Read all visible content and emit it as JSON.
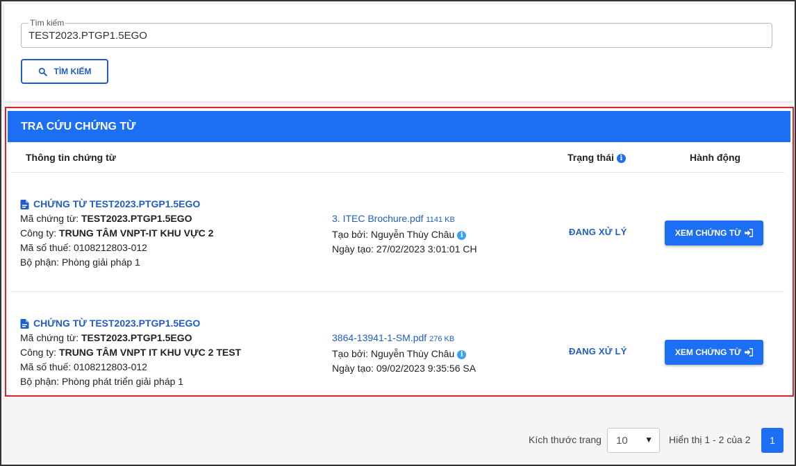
{
  "search": {
    "label": "Tìm kiếm",
    "value": "TEST2023.PTGP1.5EGO",
    "button_label": "TÌM KIẾM"
  },
  "results": {
    "title": "TRA CỨU CHỨNG TỪ",
    "columns": {
      "info": "Thông tin chứng từ",
      "status": "Trạng thái",
      "action": "Hành động"
    },
    "rows": [
      {
        "title": "CHỨNG TỪ TEST2023.PTGP1.5EGO",
        "code_label": "Mã chứng từ:",
        "code": "TEST2023.PTGP1.5EGO",
        "company_label": "Công ty:",
        "company": "TRUNG TÂM VNPT-IT KHU VỰC 2",
        "tax": "Mã số thuế: 0108212803-012",
        "dept": "Bộ phận: Phòng giải pháp 1",
        "file_name": "3. ITEC Brochure.pdf",
        "file_size": "1141 KB",
        "created_by": "Tạo bởi: Nguyễn Thùy Châu",
        "created_at": "Ngày tạo: 27/02/2023 3:01:01 CH",
        "status": "ĐANG XỬ LÝ",
        "action_label": "XEM CHỨNG TỪ"
      },
      {
        "title": "CHỨNG TỪ TEST2023.PTGP1.5EGO",
        "code_label": "Mã chứng từ:",
        "code": "TEST2023.PTGP1.5EGO",
        "company_label": "Công ty:",
        "company": "TRUNG TÂM VNPT IT KHU VỰC 2 TEST",
        "tax": "Mã số thuế: 0108212803-012",
        "dept": "Bộ phận: Phòng phát triển giải pháp 1",
        "file_name": "3864-13941-1-SM.pdf",
        "file_size": "276 KB",
        "created_by": "Tạo bởi: Nguyễn Thùy Châu",
        "created_at": "Ngày tạo: 09/02/2023 9:35:56 SA",
        "status": "ĐANG XỬ LÝ",
        "action_label": "XEM CHỨNG TỪ"
      }
    ]
  },
  "pagination": {
    "page_size_label": "Kích thước trang",
    "page_size": "10",
    "summary": "Hiển thị 1 - 2 của 2",
    "current_page": "1"
  },
  "colors": {
    "primary": "#1c6ef2",
    "link": "#1f5ccc",
    "highlight_border": "#d9222a"
  },
  "icons": {
    "search": "search-icon",
    "document": "file-pdf-icon",
    "info": "info-icon",
    "open": "sign-in-icon",
    "dropdown": "caret-down-icon"
  }
}
